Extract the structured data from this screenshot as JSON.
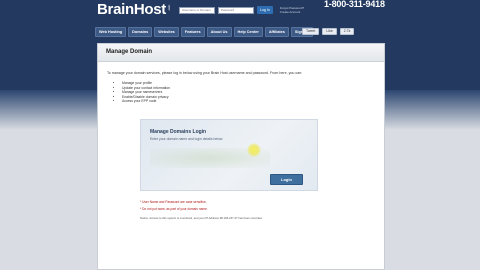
{
  "header": {
    "logo_text": "BrainHost",
    "logo_sub": ".com",
    "phone": "1-800-311-9418",
    "login": {
      "username_placeholder": "Username or Domain",
      "password_placeholder": "Password",
      "login_label": "Log In",
      "forgot_password": "Forgot Password?",
      "create_account": "Create Account"
    },
    "nav": [
      "Web Hosting",
      "Domains",
      "Websites",
      "Features",
      "About Us",
      "Help Center",
      "Affiliates",
      "Sign Up"
    ],
    "social": {
      "tweet": "Tweet",
      "like": "Like",
      "count": "2.7k"
    }
  },
  "page": {
    "title": "Manage Domain",
    "intro": "To manage your domain services, please log in below using your Brain Host username and password. From here, you can:",
    "bullets": [
      "Manage your profile",
      "Update your contact information",
      "Manage your nameservers",
      "Enable/Disable domain privacy",
      "Access your EPP code"
    ],
    "card": {
      "title": "Manage Domains Login",
      "subtitle": "Enter your domain name and login details below.",
      "login_label": "Login"
    },
    "note_1": "* User Name and Password are case sensitive.",
    "note_2": "* Do not put www. as part of your domain name.",
    "note_3": "Notice: Access to this system is monitored, and your IP Address 98.196.247.47 has been recorded."
  }
}
